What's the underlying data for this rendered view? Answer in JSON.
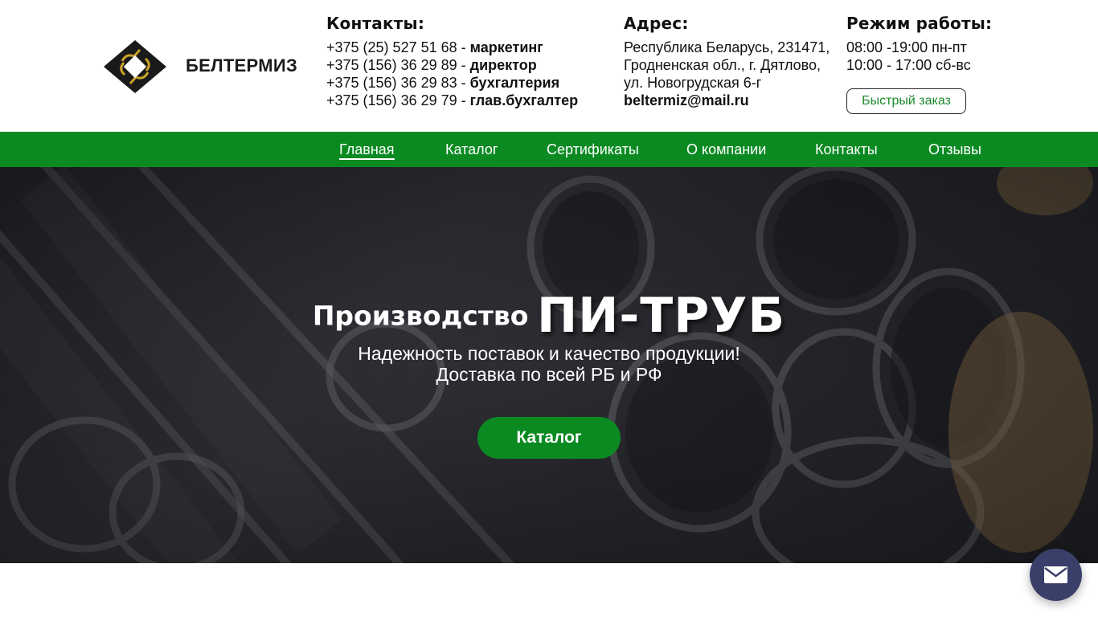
{
  "brand": {
    "name": "БЕЛТЕРМИЗ",
    "logo_icon": "belterm-logo-icon"
  },
  "contacts": {
    "title": "Контакты:",
    "lines": [
      {
        "phone": "+375 (25) 527 51 68 - ",
        "role": "маркетинг"
      },
      {
        "phone": "+375 (156) 36 29 89 - ",
        "role": "директор"
      },
      {
        "phone": "+375 (156) 36 29 83 - ",
        "role": "бухгалтерия"
      },
      {
        "phone": "+375 (156) 36 29 79 - ",
        "role": "глав.бухгалтер"
      }
    ]
  },
  "address": {
    "title": "Адрес:",
    "lines": [
      "Республика Беларусь, 231471,",
      "Гродненская обл., г. Дятлово,",
      "ул. Новогрудская 6-г"
    ],
    "email": "beltermiz@mail.ru"
  },
  "hours": {
    "title": "Режим работы:",
    "lines": [
      "08:00 -19:00 пн-пт",
      "10:00 - 17:00 сб-вс"
    ],
    "quick_order_label": "Быстрый заказ"
  },
  "nav": {
    "items": [
      "Главная",
      "Каталог",
      "Сертификаты",
      "О компании",
      "Контакты",
      "Отзывы"
    ],
    "active": "Главная"
  },
  "hero": {
    "title_small": "Производство",
    "title_big": "ПИ-ТРУБ",
    "subtitle_lines": [
      "Надежность поставок и качество продукции!",
      "Доставка по всей РБ и РФ"
    ],
    "button_label": "Каталог"
  },
  "floating": {
    "mail_icon": "mail-icon"
  },
  "colors": {
    "accent": "#0b8a22",
    "fab": "#3a3f6a",
    "hero_bg": "#2d2e35"
  }
}
